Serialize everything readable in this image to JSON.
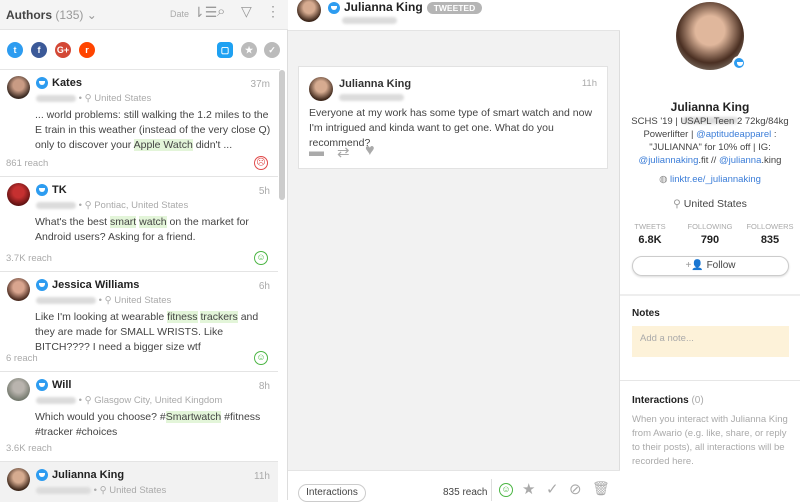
{
  "left": {
    "title": "Authors",
    "count": "(135)",
    "sort_label": "Date",
    "sources": [
      "twitter",
      "facebook",
      "google-plus",
      "reddit"
    ],
    "items": [
      {
        "name": "Kates",
        "time": "37m",
        "location": "United States",
        "text": [
          {
            "t": "... world problems: still walking the 1.2 miles to the E train in this weather (instead of the very close Q) only to discover your "
          },
          {
            "t": "Apple Watch",
            "hl": true
          },
          {
            "t": " didn't ..."
          }
        ],
        "reach": "861 reach",
        "sentiment": "negative"
      },
      {
        "name": "TK",
        "time": "5h",
        "location": "Pontiac, United States",
        "text": [
          {
            "t": "What's the best "
          },
          {
            "t": "smart",
            "hl": true
          },
          {
            "t": " "
          },
          {
            "t": "watch",
            "hl": true
          },
          {
            "t": " on the market for Android users? Asking for a friend."
          }
        ],
        "reach": "3.7K reach",
        "sentiment": "positive"
      },
      {
        "name": "Jessica Williams",
        "time": "6h",
        "location": "United States",
        "text": [
          {
            "t": "Like I'm looking at wearable "
          },
          {
            "t": "fitness",
            "hl": true
          },
          {
            "t": " "
          },
          {
            "t": "trackers",
            "hl": true
          },
          {
            "t": " and they are made for SMALL WRISTS. Like BITCH???? I need a bigger size wtf"
          }
        ],
        "reach": "6 reach",
        "sentiment": "positive"
      },
      {
        "name": "Will",
        "time": "8h",
        "location": "Glasgow City, United Kingdom",
        "text": [
          {
            "t": "Which would you choose? #"
          },
          {
            "t": "Smartwatch",
            "hl": true
          },
          {
            "t": " #fitness #tracker #choices"
          }
        ],
        "reach": "3.6K reach",
        "sentiment": "none"
      },
      {
        "name": "Julianna King",
        "time": "11h",
        "location": "United States"
      }
    ]
  },
  "mid": {
    "author": "Julianna King",
    "badge": "TWEETED",
    "post": {
      "name": "Julianna King",
      "time": "11h",
      "text": "Everyone at my work has some type of smart watch and now I'm intrigued and kinda want to get one. What do you recommend?"
    },
    "footer": {
      "interactions_label": "Interactions",
      "reach": "835 reach"
    }
  },
  "right": {
    "name": "Julianna King",
    "bio": {
      "l1": "SCHS '19 | USAPL Teen 2 72kg/84kg",
      "l2a": "Powerlifter | ",
      "l2b": "@aptitudeapparel",
      " l2c": "",
      "l2d": " :",
      "l3": "\"JULIANNA\" for 10% off | IG:",
      "l4a": "@juliannaking",
      "l4b": ".fit // ",
      "l4c": "@julianna",
      "l4d": ".king"
    },
    "website": "linktr.ee/_juliannaking",
    "location": "United States",
    "stats": [
      {
        "label": "TWEETS",
        "value": "6.8K"
      },
      {
        "label": "FOLLOWING",
        "value": "790"
      },
      {
        "label": "FOLLOWERS",
        "value": "835"
      }
    ],
    "follow_label": "Follow",
    "notes_title": "Notes",
    "notes_placeholder": "Add a note...",
    "interactions_title": "Interactions",
    "interactions_count": "(0)",
    "interactions_text": "When you interact with Julianna King from Awario (e.g. like, share, or reply to their posts), all interactions will be recorded here."
  }
}
